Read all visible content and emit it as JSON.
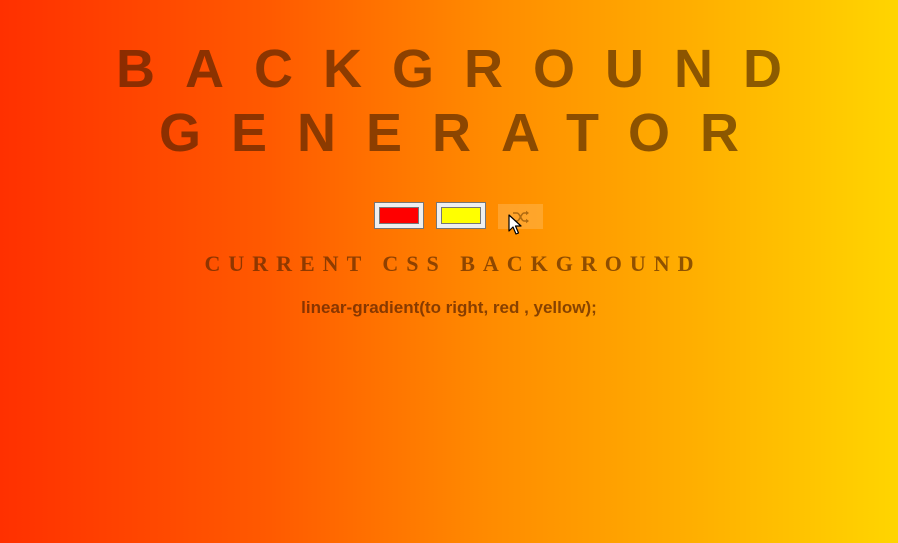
{
  "header": {
    "title_line1": "BACKGROUND",
    "title_line2": "GENERATOR"
  },
  "controls": {
    "color1": {
      "value": "red",
      "swatch_color": "#ff0000"
    },
    "color2": {
      "value": "yellow",
      "swatch_color": "#ffff00"
    },
    "random_button_icon": "shuffle-icon"
  },
  "subtitle": "CURRENT CSS BACKGROUND",
  "css_output": "linear-gradient(to right, red , yellow);",
  "colors": {
    "gradient_start": "#ff3000",
    "gradient_end": "#ffd500",
    "text": "#5a2800"
  }
}
